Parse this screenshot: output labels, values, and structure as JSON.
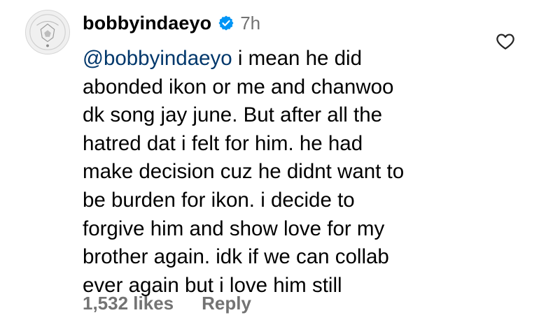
{
  "comment": {
    "username": "bobbyindaeyo",
    "timestamp": "7h",
    "verified_icon": "verified-badge-icon",
    "mention": "@bobbyindaeyo",
    "text": " i mean he did\nabonded ikon or me and chanwoo\ndk song jay  june. But after all the\nhatred dat i felt for him. he had\nmake decision cuz he didnt want to\nbe burden for ikon. i decide to\nforgive him and show love for my\nbrother again. idk if we can collab\never again but i love him still",
    "likes": "1,532 likes",
    "reply_label": "Reply",
    "like_icon": "heart-outline-icon"
  },
  "colors": {
    "mention": "#00376b",
    "secondary_text": "#737373",
    "verified_badge": "#0095f6"
  }
}
